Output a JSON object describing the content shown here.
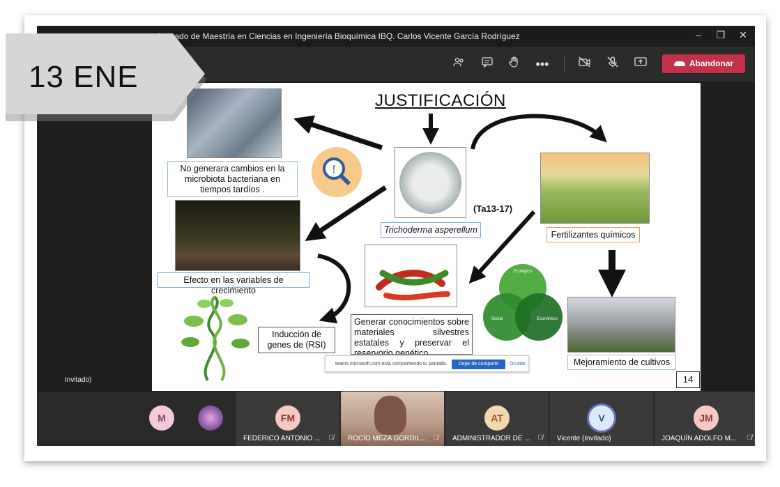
{
  "window": {
    "title": "de grado de Maestría en Ciencias en Ingeniería Bioquímica IBQ. Carlos Vicente García Rodríguez"
  },
  "toolbar": {
    "leave_label": "Abandonar"
  },
  "slide": {
    "title": "JUSTIFICACIÓN",
    "microbiota_text": "No generara cambios en la microbiota bacteriana en tiempos tardíos .",
    "trichoderma_label": "Trichoderma asperellum",
    "strain_code": "(Ta13-17)",
    "fertilizers_label": "Fertilizantes químicos",
    "growth_label": "Efecto en las variables de crecimiento",
    "knowledge_text": "Generar conocimientos sobre materiales silvestres estatales y preservar el reservorio genético",
    "induction_text": "Inducción de genes de (RSI)",
    "improvement_label": "Mejoramiento de cultivos",
    "venn_ecologico": "Ecológico",
    "venn_social": "Social",
    "venn_economico": "Económico",
    "page_number": "14"
  },
  "share_notice": {
    "message": "teams.microsoft.com está compartiendo tu pantalla.",
    "stop_label": "Dejar de compartir",
    "hide_label": "Ocultar"
  },
  "guest_label": "Invitado)",
  "participants": [
    {
      "initials": "M",
      "name": "",
      "color": "#f2cadb"
    },
    {
      "initials": "FM",
      "name": "FEDERICO ANTONIO ...",
      "color": "#f6c9c4"
    },
    {
      "initials": "",
      "name": "ROCÍO MEZA GORDIL...",
      "color": "#c9b8a8"
    },
    {
      "initials": "AT",
      "name": "ADMINISTRADOR DE ...",
      "color": "#f3d7b0"
    },
    {
      "initials": "V",
      "name": "Vicente (Invitado)",
      "color": "#d9ecf6"
    },
    {
      "initials": "JM",
      "name": "JOAQUÍN ADOLFO M...",
      "color": "#f6c9c4"
    }
  ],
  "badge": {
    "date": "13 ENE"
  }
}
